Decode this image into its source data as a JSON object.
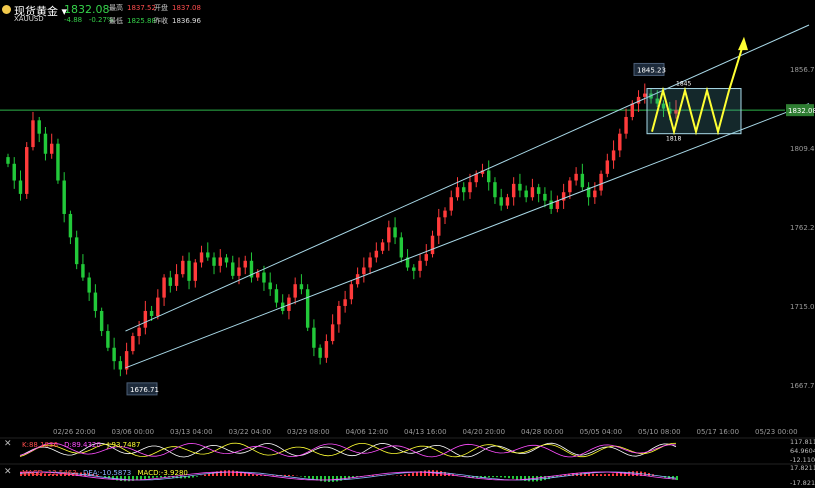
{
  "header": {
    "symbol_name": "现货黄金",
    "dropdown_glyph": "▾",
    "ticker": "XAUUSD",
    "last_price": "1832.08",
    "change": "-4.88",
    "change_pct": "-0.27%",
    "high_label": "最高",
    "high_value": "1837.52",
    "open_label": "开盘",
    "open_value": "1837.08",
    "low_label": "最低",
    "low_value": "1825.88",
    "prevclose_label": "昨收",
    "prevclose_value": "1836.96"
  },
  "colors": {
    "up": "#ff3b3b",
    "down": "#22c93a",
    "channel": "#a9d9e8",
    "projection": "#ffff33",
    "level_line": "#2db34a"
  },
  "annotations": {
    "low_march": "1676.71",
    "peak": "1845.23",
    "box_top": "1845",
    "box_bottom": "1818",
    "current_price_tag": "1832.08"
  },
  "chart_data": {
    "type": "candlestick",
    "x_tick_labels": [
      "02/26 20:00",
      "03/06 00:00",
      "03/13 04:00",
      "03/22 04:00",
      "03/29 08:00",
      "04/06 12:00",
      "04/13 16:00",
      "04/20 20:00",
      "04/28 00:00",
      "05/05 04:00",
      "05/10 08:00",
      "05/17 16:00",
      "05/23 00:00"
    ],
    "y_tick_labels": [
      "1856.72",
      "1809.48",
      "1762.25",
      "1715.01",
      "1667.77"
    ],
    "ylim": [
      1648,
      1880
    ],
    "current_price": 1832.08,
    "closes": [
      1800,
      1790,
      1782,
      1810,
      1826,
      1818,
      1806,
      1812,
      1790,
      1770,
      1756,
      1740,
      1732,
      1723,
      1712,
      1700,
      1690,
      1682,
      1677,
      1688,
      1697,
      1702,
      1712,
      1709,
      1720,
      1732,
      1727,
      1734,
      1742,
      1730,
      1741,
      1747,
      1744,
      1739,
      1744,
      1741,
      1733,
      1738,
      1742,
      1732,
      1735,
      1729,
      1725,
      1717,
      1712,
      1720,
      1728,
      1725,
      1702,
      1690,
      1684,
      1694,
      1704,
      1715,
      1719,
      1728,
      1734,
      1738,
      1744,
      1748,
      1753,
      1762,
      1756,
      1744,
      1738,
      1736,
      1742,
      1746,
      1757,
      1768,
      1772,
      1780,
      1786,
      1783,
      1789,
      1794,
      1796,
      1789,
      1780,
      1775,
      1780,
      1788,
      1784,
      1780,
      1786,
      1782,
      1778,
      1773,
      1778,
      1783,
      1790,
      1794,
      1786,
      1780,
      1784,
      1794,
      1802,
      1808,
      1818,
      1828,
      1836,
      1840,
      1842,
      1839,
      1836,
      1833,
      1830,
      1832.08
    ],
    "channel": {
      "upper": [
        [
          "03/06 00:00",
          1700
        ],
        [
          "05/23 00:00",
          1883
        ]
      ],
      "lower": [
        [
          "03/06 00:00",
          1678
        ],
        [
          "05/23 00:00",
          1836
        ]
      ]
    },
    "projection_box": {
      "top": 1845,
      "bottom": 1818
    },
    "indicators": {
      "kdj": {
        "k_label": "K:88.1836",
        "d_label": "D:89.4320",
        "j_label": "J:93.7487",
        "ticks": [
          "117.811",
          "64.9604",
          "-12.1102"
        ]
      },
      "macd": {
        "label": "MACD",
        "dif_label": "-12.5463",
        "dea_label": "DEA:-10.5873",
        "macd_label": "MACD:-3.9280",
        "ticks": [
          "17.8211",
          "-17.8211"
        ]
      }
    }
  }
}
